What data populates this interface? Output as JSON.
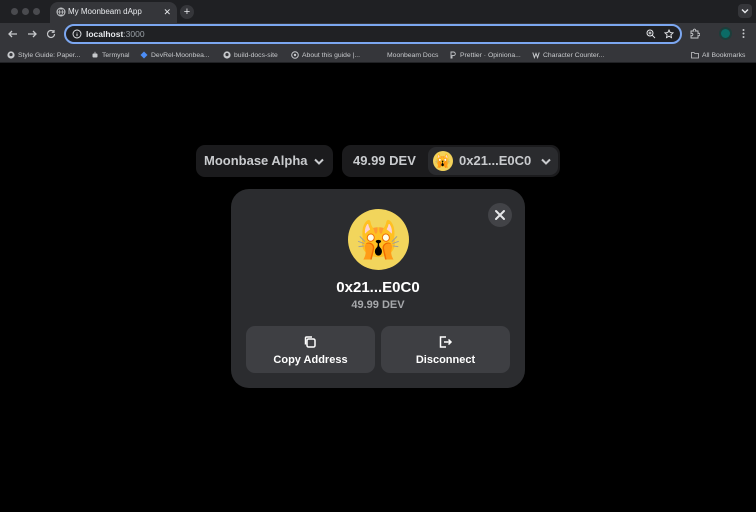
{
  "browser": {
    "tab": {
      "title": "My Moonbeam dApp",
      "close_glyph": "✕",
      "favicon": "globe-icon"
    },
    "new_tab_glyph": "+",
    "url": {
      "host": "localhost",
      "port": ":3000"
    },
    "bookmarks": [
      {
        "label": "Style Guide: Paper...",
        "icon": "github-icon"
      },
      {
        "label": "Termynal",
        "icon": "robot-icon"
      },
      {
        "label": "DevRel-Moonbea...",
        "icon": "jira-icon"
      },
      {
        "label": "build-docs-site",
        "icon": "github-icon"
      },
      {
        "label": "About this guide |...",
        "icon": "globe-icon"
      },
      {
        "label": "Moonbeam Docs",
        "icon": "blank-icon"
      },
      {
        "label": "Prettier · Opiniona...",
        "icon": "prettier-icon"
      },
      {
        "label": "Character Counter...",
        "icon": "w-icon"
      }
    ],
    "all_bookmarks": "All Bookmarks",
    "profile_initial": "D"
  },
  "dapp": {
    "network_label": "Moonbase Alpha",
    "balance_label": "49.99 DEV",
    "account_short": "0x21...E0C0",
    "avatar_emoji": "🙀"
  },
  "modal": {
    "avatar_emoji": "🙀",
    "address": "0x21...E0C0",
    "balance": "49.99 DEV",
    "copy_label": "Copy Address",
    "disconnect_label": "Disconnect"
  },
  "colors": {
    "page_bg": "#000000",
    "modal_bg": "#2b2c2f",
    "button_bg": "#3e3f43",
    "avatar_bg": "#f2d55c",
    "omnibox_focus": "#7ca7f0"
  }
}
